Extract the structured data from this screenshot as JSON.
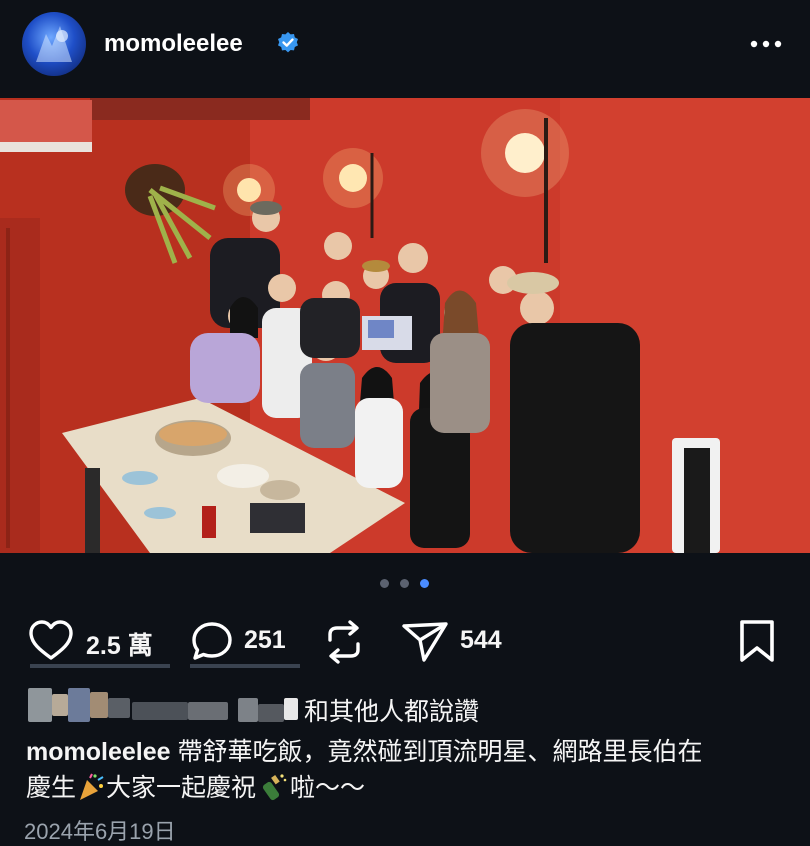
{
  "post": {
    "username": "momoleelee",
    "verified": true,
    "carousel": {
      "total": 3,
      "active": 3
    },
    "photo_alt": "group-dinner-photo"
  },
  "actions": {
    "likes": "2.5 萬",
    "comments": "251",
    "shares": "544"
  },
  "liked_by": {
    "suffix": "和其他人都說讚"
  },
  "caption": {
    "username": "momoleelee",
    "line1": "帶舒華吃飯，竟然碰到頂流明星、網路里長伯在",
    "line2_a": "慶生",
    "line2_b": "大家一起慶祝",
    "line2_c": "啦～～"
  },
  "date": "2024年6月19日",
  "colors": {
    "background": "#0d1117",
    "accent_blue": "#4a8cff",
    "wall_red": "#c9372a"
  },
  "icons": [
    "verified-icon",
    "more-icon",
    "heart-icon",
    "comment-icon",
    "repost-icon",
    "share-icon",
    "bookmark-icon",
    "party-popper-icon",
    "champagne-icon",
    "person-tag-icon"
  ]
}
